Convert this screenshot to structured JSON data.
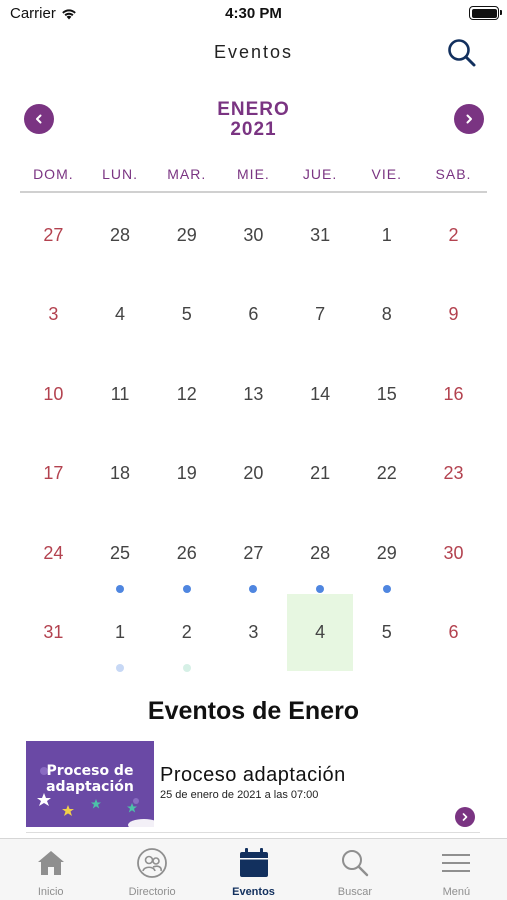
{
  "status_bar": {
    "carrier": "Carrier",
    "time": "4:30 PM"
  },
  "header": {
    "title": "Eventos",
    "search_icon": "search-icon"
  },
  "calendar": {
    "month": "ENERO",
    "year": "2021",
    "weekdays": [
      "DOM.",
      "LUN.",
      "MAR.",
      "MIE.",
      "JUE.",
      "VIE.",
      "SAB."
    ],
    "weeks": [
      [
        "27",
        "28",
        "29",
        "30",
        "31",
        "1",
        "2"
      ],
      [
        "3",
        "4",
        "5",
        "6",
        "7",
        "8",
        "9"
      ],
      [
        "10",
        "11",
        "12",
        "13",
        "14",
        "15",
        "16"
      ],
      [
        "17",
        "18",
        "19",
        "20",
        "21",
        "22",
        "23"
      ],
      [
        "24",
        "25",
        "26",
        "27",
        "28",
        "29",
        "30"
      ],
      [
        "31",
        "1",
        "2",
        "3",
        "4",
        "5",
        "6"
      ]
    ],
    "colors": {
      "accent": "#7a3482",
      "weekend": "#b3424f",
      "event_dot": "#4f86e0",
      "today_bg": "#e7f7e1"
    }
  },
  "events": {
    "heading": "Eventos de Enero",
    "items": [
      {
        "thumb_text": "Proceso de adaptación",
        "title": "Proceso adaptación",
        "date": "25 de enero de 2021 a las 07:00"
      }
    ]
  },
  "tabs": [
    {
      "label": "Inicio",
      "icon": "home-icon",
      "active": false
    },
    {
      "label": "Directorio",
      "icon": "directory-icon",
      "active": false
    },
    {
      "label": "Eventos",
      "icon": "calendar-icon",
      "active": true
    },
    {
      "label": "Buscar",
      "icon": "search-icon",
      "active": false
    },
    {
      "label": "Menú",
      "icon": "menu-icon",
      "active": false
    }
  ]
}
